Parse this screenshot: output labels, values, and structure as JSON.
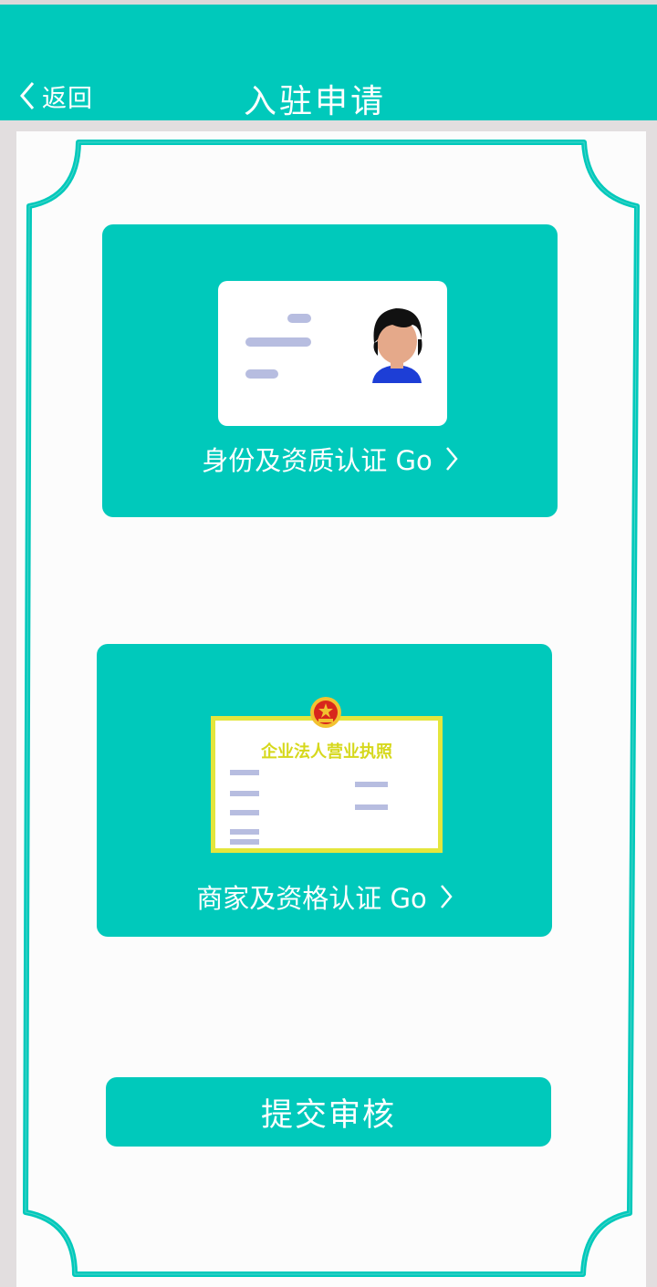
{
  "header": {
    "back_label": "返回",
    "title": "入驻申请"
  },
  "cards": [
    {
      "label": "身份及资质认证 Go",
      "illustration": "id-card-illustration"
    },
    {
      "label": "商家及资格认证 Go",
      "illustration": "business-license-illustration",
      "license_title": "企业法人营业执照"
    }
  ],
  "submit_label": "提交审核",
  "colors": {
    "primary": "#00c9bb",
    "panel": "#fcfcfc",
    "background": "#e2dedf",
    "placeholder_bars": "#b7bde0",
    "license_yellow": "#e4e63c",
    "avatar_shirt": "#1d3ed6"
  }
}
